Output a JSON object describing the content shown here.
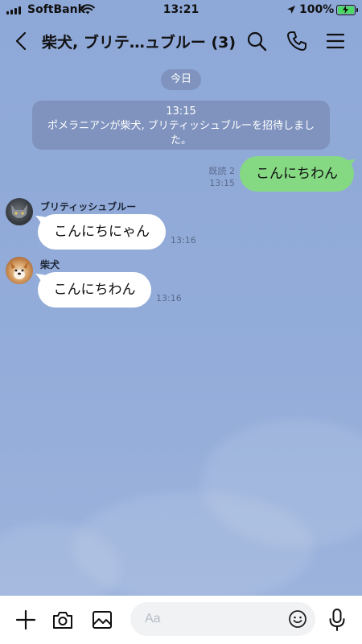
{
  "status_bar": {
    "carrier": "SoftBank",
    "time": "13:21",
    "battery": "100%"
  },
  "header": {
    "title": "柴犬, ブリテ…ュブルー (3)"
  },
  "chat": {
    "date_divider": "今日",
    "system_message": {
      "time": "13:15",
      "text": "ポメラニアンが柴犬, ブリティッシュブルーを招待しました。"
    },
    "messages": [
      {
        "side": "right",
        "text": "こんにちわん",
        "read_label": "既読 2",
        "time": "13:15"
      },
      {
        "side": "left",
        "sender": "ブリティッシュブルー",
        "text": "こんにちにゃん",
        "time": "13:16"
      },
      {
        "side": "left",
        "sender": "柴犬",
        "text": "こんにちわん",
        "time": "13:16"
      }
    ]
  },
  "composer": {
    "placeholder": "Aa"
  },
  "colors": {
    "background": "#93a9d6",
    "sent_bubble": "#85d983",
    "received_bubble": "#ffffff",
    "pill": "#7f93be"
  }
}
